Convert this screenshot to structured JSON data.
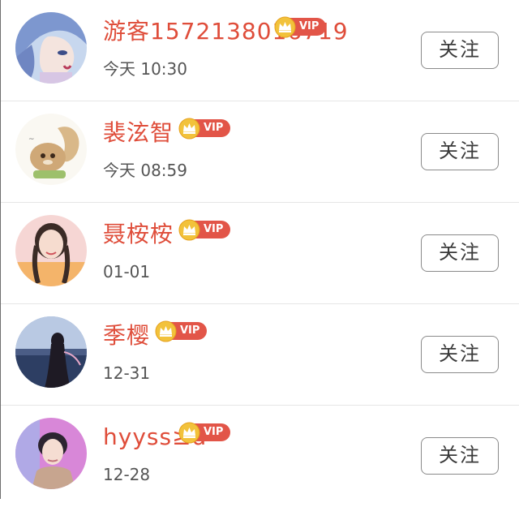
{
  "users": [
    {
      "name": "游客1572138016719",
      "badge": "VIP",
      "time": "今天 10:30",
      "follow_label": "关注",
      "avatar_icon": "blue-hair-anime-avatar"
    },
    {
      "name": "裴泫智",
      "badge": "VIP",
      "time": "今天 08:59",
      "follow_label": "关注",
      "avatar_icon": "cartoon-squirrel-avatar"
    },
    {
      "name": "聂桉桉",
      "badge": "VIP",
      "time": "01-01",
      "follow_label": "关注",
      "avatar_icon": "girl-braids-avatar"
    },
    {
      "name": "季樱",
      "badge": "VIP",
      "time": "12-31",
      "follow_label": "关注",
      "avatar_icon": "girl-city-night-avatar"
    },
    {
      "name": "hyyss≥d",
      "badge": "VIP",
      "time": "12-28",
      "follow_label": "关注",
      "avatar_icon": "boy-pink-background-avatar"
    }
  ],
  "colors": {
    "name": "#df4d3a",
    "vip_badge": "#e25548",
    "crown": "#f2c23b",
    "time": "#555555",
    "button_border": "#8a8a8a"
  }
}
